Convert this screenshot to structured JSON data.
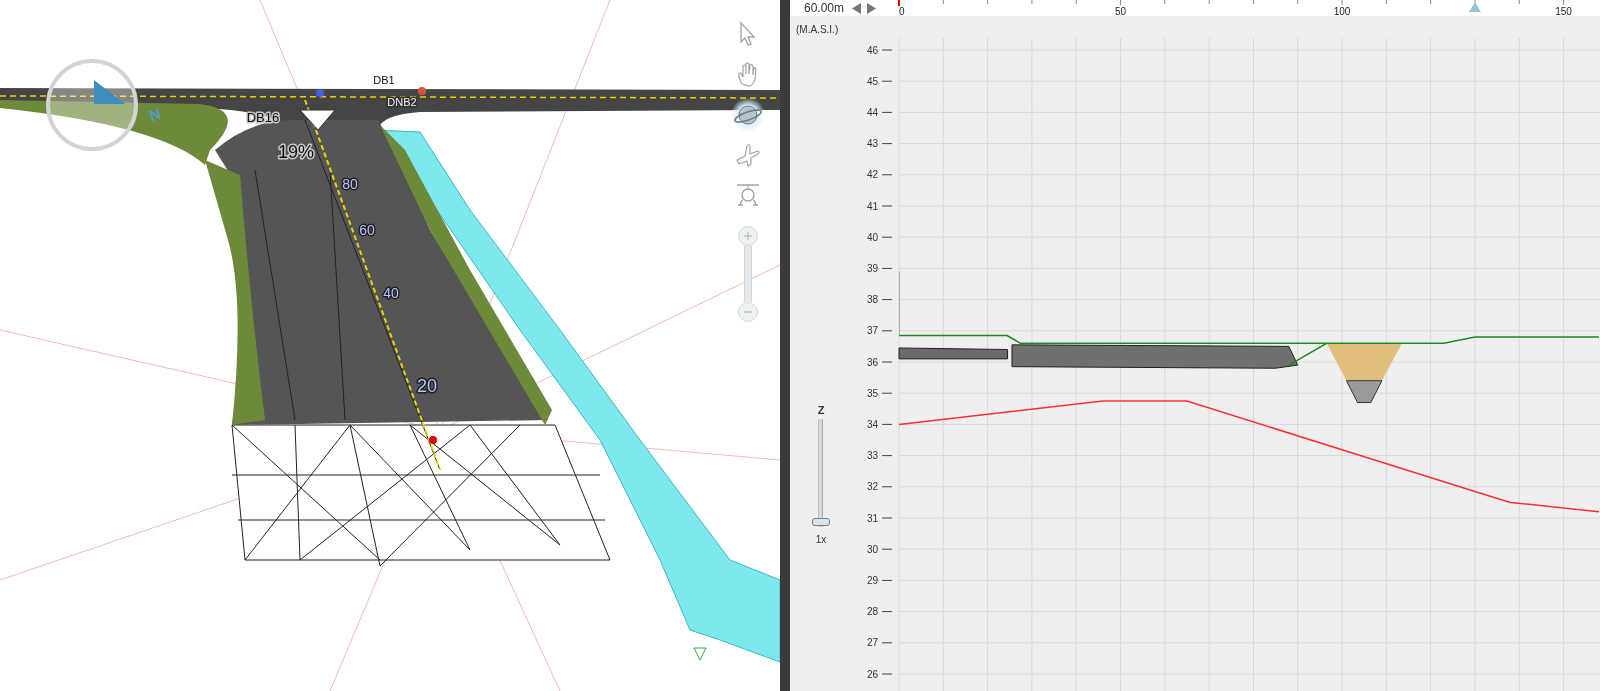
{
  "viewport": {
    "compass": {
      "label": "N"
    },
    "labels": [
      {
        "text": "DB16"
      },
      {
        "text": "DB1"
      },
      {
        "text": "DNB2"
      },
      {
        "text": "19%"
      },
      {
        "text": "80"
      },
      {
        "text": "60"
      },
      {
        "text": "40"
      },
      {
        "text": "20"
      }
    ],
    "tools": [
      {
        "kind": "select",
        "selected": false
      },
      {
        "kind": "pan",
        "selected": false
      },
      {
        "kind": "orbit",
        "selected": true
      },
      {
        "kind": "fly",
        "selected": false
      },
      {
        "kind": "helicopter",
        "selected": false
      }
    ]
  },
  "profile": {
    "scale": "60.00m",
    "y_unit": "(M.A.S.I.)",
    "z_slider": {
      "label": "Z",
      "level": 0,
      "zoom": "1x"
    },
    "chart_data": {
      "type": "line",
      "grid": true,
      "x": [
        0,
        24.4,
        27.4,
        46,
        65,
        123,
        130,
        138,
        158
      ],
      "series": [
        {
          "color": "#ff3030",
          "values": [
            34.0,
            34.4,
            34.45,
            34.75,
            34.75,
            32.16,
            31.85,
            31.5,
            31.2
          ]
        },
        {
          "color": "#1a8a1a",
          "values": [
            36.85,
            36.85,
            36.6,
            36.6,
            36.6,
            36.6,
            36.8,
            36.8,
            36.8
          ]
        }
      ],
      "xlim": [
        0,
        158
      ],
      "ylim": [
        26,
        46.5
      ],
      "xticks": [
        0,
        50,
        100,
        150
      ],
      "yticks": [
        26,
        27,
        28,
        29,
        30,
        31,
        32,
        33,
        34,
        35,
        36,
        37,
        38,
        39,
        40,
        41,
        42,
        43,
        44,
        45,
        46
      ]
    }
  }
}
